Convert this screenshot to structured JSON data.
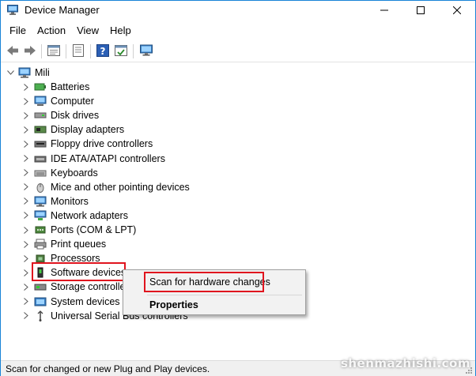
{
  "window": {
    "title": "Device Manager"
  },
  "menu": [
    "File",
    "Action",
    "View",
    "Help"
  ],
  "tree": {
    "root": "Mili",
    "categories": [
      "Batteries",
      "Computer",
      "Disk drives",
      "Display adapters",
      "Floppy drive controllers",
      "IDE ATA/ATAPI controllers",
      "Keyboards",
      "Mice and other pointing devices",
      "Monitors",
      "Network adapters",
      "Ports (COM & LPT)",
      "Print queues",
      "Processors",
      "Software devices",
      "Storage controllers",
      "System devices",
      "Universal Serial Bus controllers"
    ],
    "selected": "Software devices"
  },
  "context_menu": {
    "items": [
      "Scan for hardware changes",
      "Properties"
    ],
    "highlighted": "Scan for hardware changes"
  },
  "status_bar": {
    "text": "Scan for changed or new Plug and Play devices."
  },
  "watermark": "shenmazhishi.com",
  "colors": {
    "highlight_border": "#e0141e",
    "window_border": "#1883d7",
    "selection": "#cce8ff"
  },
  "icons": [
    "device-manager-icon",
    "back-arrow-icon",
    "forward-arrow-icon",
    "properties-icon",
    "update-driver-icon",
    "help-icon",
    "action-icon",
    "monitor-scan-icon"
  ]
}
